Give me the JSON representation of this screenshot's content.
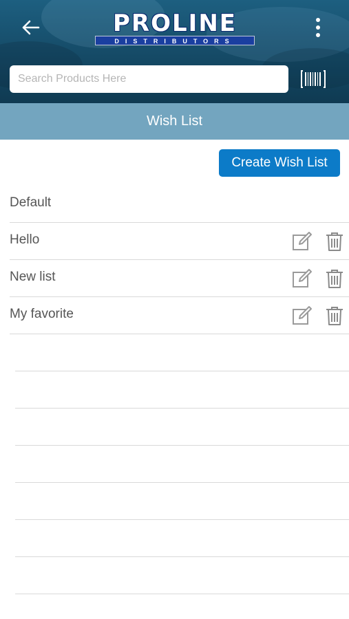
{
  "header": {
    "logo_brand": "PROLINE",
    "logo_tagline": "DISTRIBUTORS",
    "back_icon": "arrow-left-icon",
    "menu_icon": "more-vertical-icon",
    "barcode_icon": "barcode-icon",
    "background_color": "#154a66"
  },
  "search": {
    "placeholder": "Search Products Here",
    "value": ""
  },
  "page": {
    "title": "Wish List",
    "title_bar_color": "#73a5bf"
  },
  "actions": {
    "create_label": "Create Wish List",
    "create_color": "#0c7bc8"
  },
  "wishlists": [
    {
      "name": "Default",
      "editable": false
    },
    {
      "name": "Hello",
      "editable": true
    },
    {
      "name": "New list",
      "editable": true
    },
    {
      "name": "My favorite",
      "editable": true
    }
  ],
  "row_icons": {
    "edit": "edit-icon",
    "delete": "trash-icon"
  }
}
